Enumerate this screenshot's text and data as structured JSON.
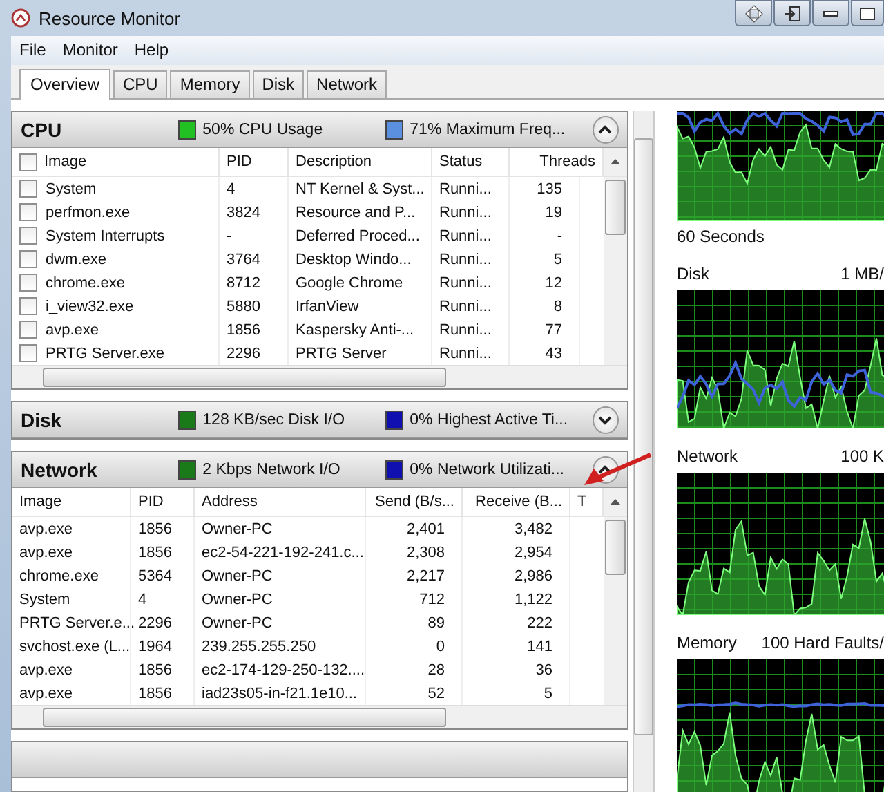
{
  "window": {
    "title": "Resource Monitor"
  },
  "menu": [
    "File",
    "Monitor",
    "Help"
  ],
  "tabs": [
    {
      "label": "Overview",
      "selected": true
    },
    {
      "label": "CPU",
      "selected": false
    },
    {
      "label": "Memory",
      "selected": false
    },
    {
      "label": "Disk",
      "selected": false
    },
    {
      "label": "Network",
      "selected": false
    }
  ],
  "sections": [
    {
      "title": "CPU",
      "expanded": true,
      "legend": [
        {
          "text": "50% CPU Usage",
          "color": "#22c022"
        },
        {
          "text": "71% Maximum Freq...",
          "color": "#5b8fe0"
        }
      ],
      "table": {
        "all_checked": false,
        "columns": [
          "Image",
          "PID",
          "Description",
          "Status",
          "Threads"
        ],
        "rows": [
          {
            "checked": false,
            "cells": [
              "System",
              "4",
              "NT Kernel & Syst...",
              "Runni...",
              "135"
            ]
          },
          {
            "checked": false,
            "cells": [
              "perfmon.exe",
              "3824",
              "Resource and P...",
              "Runni...",
              "19"
            ]
          },
          {
            "checked": false,
            "cells": [
              "System Interrupts",
              "-",
              "Deferred Proced...",
              "Runni...",
              "-"
            ]
          },
          {
            "checked": false,
            "cells": [
              "dwm.exe",
              "3764",
              "Desktop Windo...",
              "Runni...",
              "5"
            ]
          },
          {
            "checked": false,
            "cells": [
              "chrome.exe",
              "8712",
              "Google Chrome",
              "Runni...",
              "12"
            ]
          },
          {
            "checked": false,
            "cells": [
              "i_view32.exe",
              "5880",
              "IrfanView",
              "Runni...",
              "8"
            ]
          },
          {
            "checked": false,
            "cells": [
              "avp.exe",
              "1856",
              "Kaspersky Anti-...",
              "Runni...",
              "77"
            ]
          },
          {
            "checked": false,
            "cells": [
              "PRTG Server.exe",
              "2296",
              "PRTG Server",
              "Runni...",
              "43"
            ]
          }
        ]
      }
    },
    {
      "title": "Disk",
      "expanded": false,
      "legend": [
        {
          "text": "128 KB/sec Disk I/O",
          "color": "#1a7a1a"
        },
        {
          "text": "0% Highest Active Ti...",
          "color": "#1010b0"
        }
      ]
    },
    {
      "title": "Network",
      "expanded": true,
      "legend": [
        {
          "text": "2 Kbps Network I/O",
          "color": "#1a7a1a"
        },
        {
          "text": "0% Network Utilizati...",
          "color": "#1010b0"
        }
      ],
      "table": {
        "columns": [
          "Image",
          "PID",
          "Address",
          "Send (B/s...",
          "Receive (B...",
          "T"
        ],
        "rows": [
          {
            "cells": [
              "avp.exe",
              "1856",
              "Owner-PC",
              "2,401",
              "3,482"
            ]
          },
          {
            "cells": [
              "avp.exe",
              "1856",
              "ec2-54-221-192-241.c...",
              "2,308",
              "2,954"
            ]
          },
          {
            "cells": [
              "chrome.exe",
              "5364",
              "Owner-PC",
              "2,217",
              "2,986"
            ]
          },
          {
            "cells": [
              "System",
              "4",
              "Owner-PC",
              "712",
              "1,122"
            ]
          },
          {
            "cells": [
              "PRTG Server.e...",
              "2296",
              "Owner-PC",
              "89",
              "222"
            ]
          },
          {
            "cells": [
              "svchost.exe (L...",
              "1964",
              "239.255.255.250",
              "0",
              "141"
            ]
          },
          {
            "cells": [
              "avp.exe",
              "1856",
              "ec2-174-129-250-132....",
              "28",
              "36"
            ]
          },
          {
            "cells": [
              "avp.exe",
              "1856",
              "iad23s05-in-f21.1e10...",
              "52",
              "5"
            ]
          }
        ]
      }
    }
  ],
  "graphs": [
    {
      "caption": "60 Seconds"
    },
    {
      "label": "Disk",
      "scale": "1 MB/"
    },
    {
      "label": "Network",
      "scale": "100 K"
    },
    {
      "label": "Memory",
      "scale": "100 Hard Faults/"
    }
  ]
}
